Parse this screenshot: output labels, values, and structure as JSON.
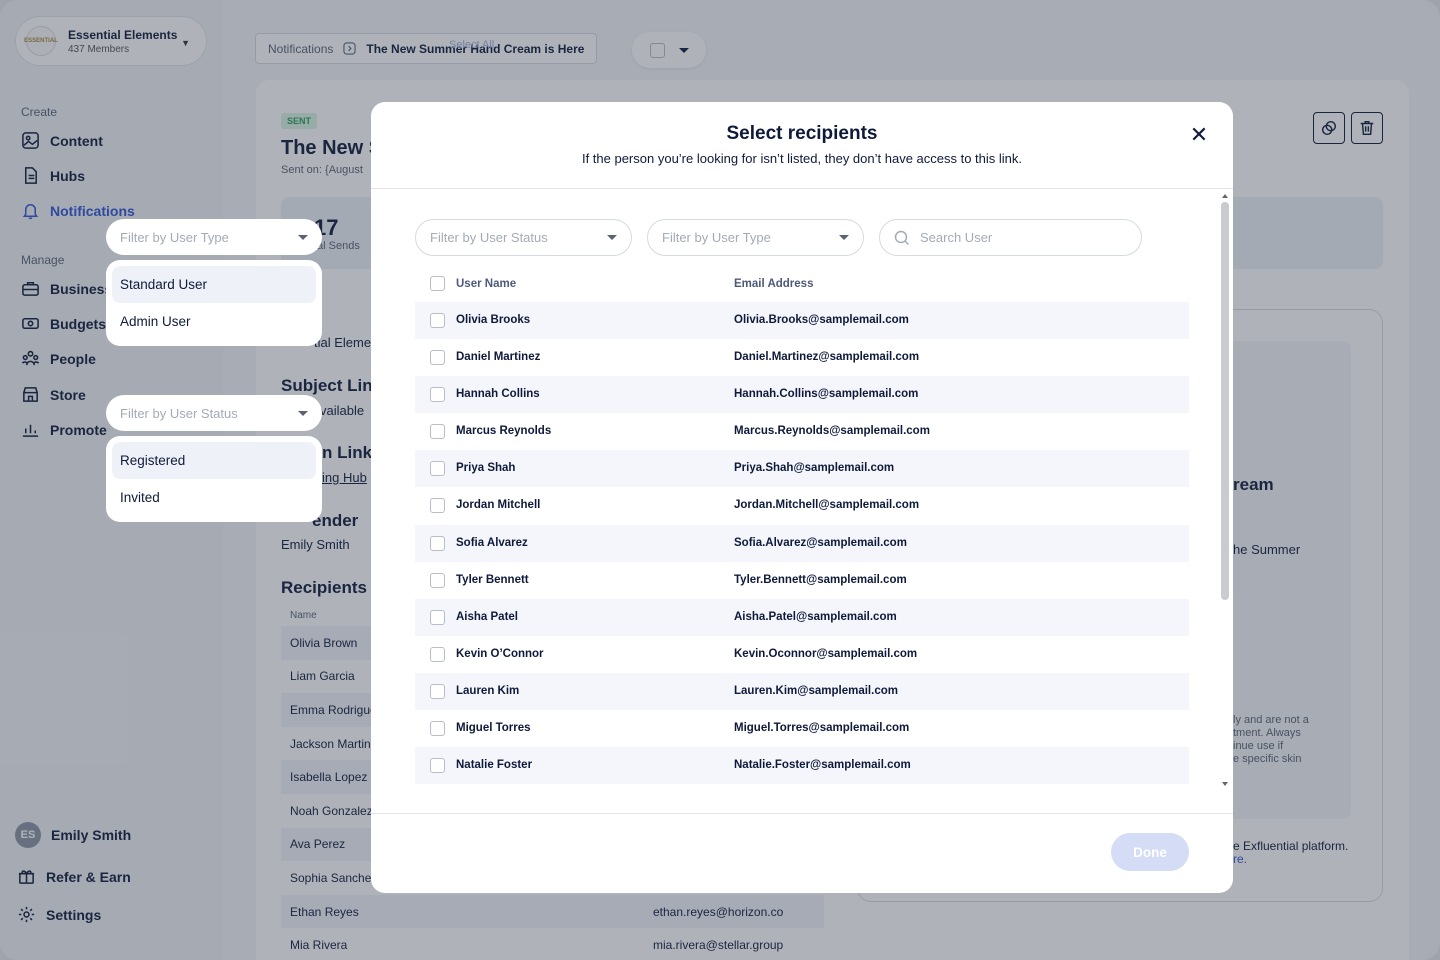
{
  "org": {
    "name": "Essential Elements",
    "members": "437 Members",
    "logo_text": "ESSENTIAL"
  },
  "sidebar": {
    "create_label": "Create",
    "manage_label": "Manage",
    "items": [
      {
        "label": "Content"
      },
      {
        "label": "Hubs"
      },
      {
        "label": "Notifications"
      },
      {
        "label": "Business"
      },
      {
        "label": "Budgets"
      },
      {
        "label": "People"
      },
      {
        "label": "Store"
      },
      {
        "label": "Promote"
      }
    ],
    "user": {
      "initials": "ES",
      "name": "Emily Smith"
    },
    "refer_label": "Refer & Earn",
    "settings_label": "Settings"
  },
  "breadcrumb": {
    "root": "Notifications",
    "current": "The New Summer Hand Cream is Here"
  },
  "select_all_ghost": "Select All",
  "background": {
    "badge": "SENT",
    "title": "The New S",
    "sent_on": "Sent on: {August",
    "stat_number": "17",
    "stat_label": "tal Sends",
    "hub_text": "tial Eleme",
    "subject_heading": "Subject Line",
    "subject_value": "vailable",
    "link_heading": "n Link",
    "link_value": "ing Hub",
    "sender_heading": "ender",
    "sender_value": "Emily Smith",
    "recipients_heading": "Recipients (",
    "preview_heading": "ream",
    "preview_sub": "he Summer",
    "preview_disclaimer": [
      "ly and are not a",
      "tment. Always",
      "inue use if",
      "e specific skin"
    ],
    "footer_text": "e Exfluential platform.",
    "footer_link": "Exfluential",
    "footer_text2": "re.",
    "table": {
      "header": "Name",
      "rows": [
        {
          "name": "Olivia Brown",
          "email": ""
        },
        {
          "name": "Liam Garcia",
          "email": ""
        },
        {
          "name": "Emma Rodrigue",
          "email": ""
        },
        {
          "name": "Jackson Martin",
          "email": ""
        },
        {
          "name": "Isabella Lopez",
          "email": ""
        },
        {
          "name": "Noah Gonzalez",
          "email": ""
        },
        {
          "name": "Ava Perez",
          "email": ""
        },
        {
          "name": "Sophia Sanchez",
          "email": ""
        },
        {
          "name": "Ethan Reyes",
          "email": "ethan.reyes@horizon.co"
        },
        {
          "name": "Mia Rivera",
          "email": "mia.rivera@stellar.group"
        }
      ]
    }
  },
  "floating_type_dropdown": {
    "placeholder": "Filter by User Type",
    "options": [
      "Standard User",
      "Admin User"
    ]
  },
  "floating_status_dropdown": {
    "placeholder": "Filter by User Status",
    "options": [
      "Registered",
      "Invited"
    ]
  },
  "modal": {
    "title": "Select recipients",
    "subtitle": "If the person you’re looking for isn’t listed, they don’t have access to this link.",
    "status_filter_placeholder": "Filter by User Status",
    "type_filter_placeholder": "Filter by User Type",
    "search_placeholder": "Search User",
    "col_name": "User Name",
    "col_email": "Email Address",
    "rows": [
      {
        "name": "Olivia Brooks",
        "email": "Olivia.Brooks@samplemail.com"
      },
      {
        "name": "Daniel Martinez",
        "email": "Daniel.Martinez@samplemail.com"
      },
      {
        "name": "Hannah Collins",
        "email": "Hannah.Collins@samplemail.com"
      },
      {
        "name": "Marcus Reynolds",
        "email": "Marcus.Reynolds@samplemail.com"
      },
      {
        "name": "Priya Shah",
        "email": "Priya.Shah@samplemail.com"
      },
      {
        "name": "Jordan Mitchell",
        "email": "Jordan.Mitchell@samplemail.com"
      },
      {
        "name": "Sofia Alvarez",
        "email": "Sofia.Alvarez@samplemail.com"
      },
      {
        "name": "Tyler Bennett",
        "email": "Tyler.Bennett@samplemail.com"
      },
      {
        "name": "Aisha Patel",
        "email": "Aisha.Patel@samplemail.com"
      },
      {
        "name": "Kevin O’Connor",
        "email": "Kevin.Oconnor@samplemail.com"
      },
      {
        "name": "Lauren Kim",
        "email": "Lauren.Kim@samplemail.com"
      },
      {
        "name": "Miguel Torres",
        "email": "Miguel.Torres@samplemail.com"
      },
      {
        "name": "Natalie Foster",
        "email": "Natalie.Foster@samplemail.com"
      }
    ],
    "done_label": "Done"
  },
  "colors": {
    "accent": "#2f54d6",
    "done_disabled": "#d4dcf6",
    "sent_badge": "#2f9a5c"
  }
}
